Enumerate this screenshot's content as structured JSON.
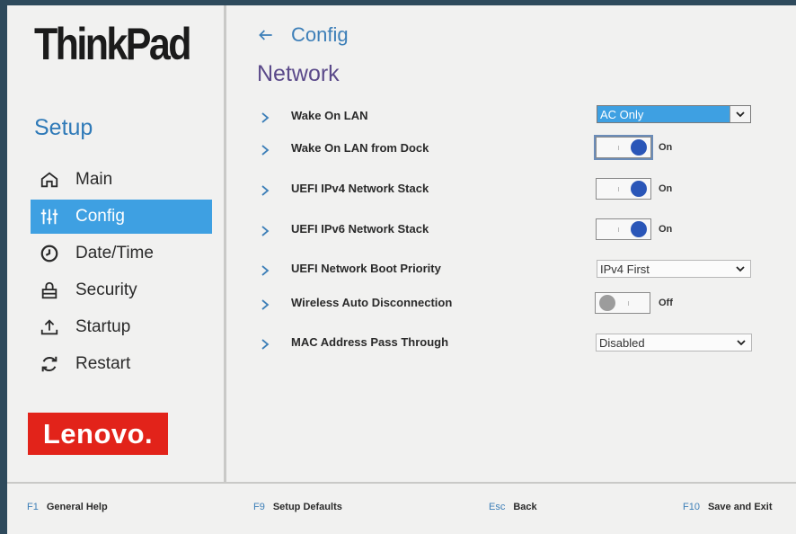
{
  "brand": "ThinkPad",
  "sidebar": {
    "title": "Setup",
    "items": [
      {
        "label": "Main",
        "icon": "home-icon"
      },
      {
        "label": "Config",
        "icon": "sliders-icon",
        "active": true
      },
      {
        "label": "Date/Time",
        "icon": "clock-icon"
      },
      {
        "label": "Security",
        "icon": "lock-icon"
      },
      {
        "label": "Startup",
        "icon": "upload-icon"
      },
      {
        "label": "Restart",
        "icon": "refresh-icon"
      }
    ],
    "logo": "Lenovo."
  },
  "breadcrumb": {
    "label": "Config",
    "icon": "back-arrow-icon"
  },
  "page_title": "Network",
  "settings": [
    {
      "label": "Wake On LAN",
      "type": "select",
      "value": "AC Only",
      "highlight": true
    },
    {
      "label": "Wake On LAN from Dock",
      "type": "toggle",
      "value": "On"
    },
    {
      "label": "UEFI IPv4 Network Stack",
      "type": "toggle",
      "value": "On"
    },
    {
      "label": "UEFI IPv6 Network Stack",
      "type": "toggle",
      "value": "On"
    },
    {
      "label": "UEFI Network Boot Priority",
      "type": "select",
      "value": "IPv4 First"
    },
    {
      "label": "Wireless Auto Disconnection",
      "type": "toggle",
      "value": "Off"
    },
    {
      "label": "MAC Address Pass Through",
      "type": "select",
      "value": "Disabled"
    }
  ],
  "footer": [
    {
      "key": "F1",
      "action": "General Help"
    },
    {
      "key": "F9",
      "action": "Setup Defaults"
    },
    {
      "key": "Esc",
      "action": "Back"
    },
    {
      "key": "F10",
      "action": "Save and Exit"
    }
  ],
  "colors": {
    "accent": "#3ea0e2",
    "toggle_on": "#2a56b8",
    "title": "#5b4a8a",
    "lenovo_red": "#e2231a"
  }
}
